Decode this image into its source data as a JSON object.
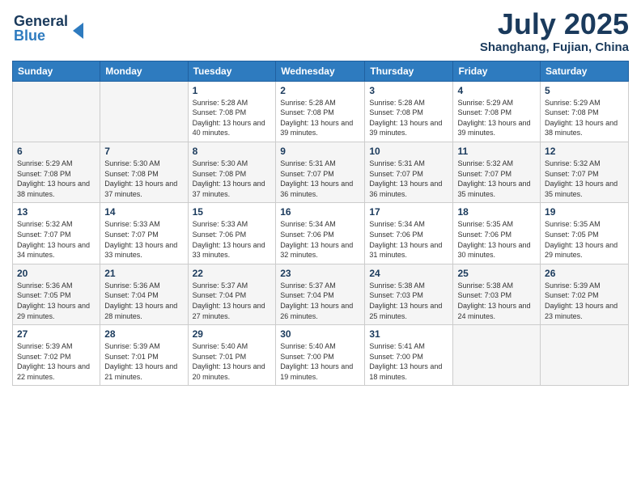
{
  "logo": {
    "line1": "General",
    "line2": "Blue"
  },
  "title": "July 2025",
  "location": "Shanghang, Fujian, China",
  "days_of_week": [
    "Sunday",
    "Monday",
    "Tuesday",
    "Wednesday",
    "Thursday",
    "Friday",
    "Saturday"
  ],
  "weeks": [
    [
      {
        "day": "",
        "info": ""
      },
      {
        "day": "",
        "info": ""
      },
      {
        "day": "1",
        "info": "Sunrise: 5:28 AM\nSunset: 7:08 PM\nDaylight: 13 hours and 40 minutes."
      },
      {
        "day": "2",
        "info": "Sunrise: 5:28 AM\nSunset: 7:08 PM\nDaylight: 13 hours and 39 minutes."
      },
      {
        "day": "3",
        "info": "Sunrise: 5:28 AM\nSunset: 7:08 PM\nDaylight: 13 hours and 39 minutes."
      },
      {
        "day": "4",
        "info": "Sunrise: 5:29 AM\nSunset: 7:08 PM\nDaylight: 13 hours and 39 minutes."
      },
      {
        "day": "5",
        "info": "Sunrise: 5:29 AM\nSunset: 7:08 PM\nDaylight: 13 hours and 38 minutes."
      }
    ],
    [
      {
        "day": "6",
        "info": "Sunrise: 5:29 AM\nSunset: 7:08 PM\nDaylight: 13 hours and 38 minutes."
      },
      {
        "day": "7",
        "info": "Sunrise: 5:30 AM\nSunset: 7:08 PM\nDaylight: 13 hours and 37 minutes."
      },
      {
        "day": "8",
        "info": "Sunrise: 5:30 AM\nSunset: 7:08 PM\nDaylight: 13 hours and 37 minutes."
      },
      {
        "day": "9",
        "info": "Sunrise: 5:31 AM\nSunset: 7:07 PM\nDaylight: 13 hours and 36 minutes."
      },
      {
        "day": "10",
        "info": "Sunrise: 5:31 AM\nSunset: 7:07 PM\nDaylight: 13 hours and 36 minutes."
      },
      {
        "day": "11",
        "info": "Sunrise: 5:32 AM\nSunset: 7:07 PM\nDaylight: 13 hours and 35 minutes."
      },
      {
        "day": "12",
        "info": "Sunrise: 5:32 AM\nSunset: 7:07 PM\nDaylight: 13 hours and 35 minutes."
      }
    ],
    [
      {
        "day": "13",
        "info": "Sunrise: 5:32 AM\nSunset: 7:07 PM\nDaylight: 13 hours and 34 minutes."
      },
      {
        "day": "14",
        "info": "Sunrise: 5:33 AM\nSunset: 7:07 PM\nDaylight: 13 hours and 33 minutes."
      },
      {
        "day": "15",
        "info": "Sunrise: 5:33 AM\nSunset: 7:06 PM\nDaylight: 13 hours and 33 minutes."
      },
      {
        "day": "16",
        "info": "Sunrise: 5:34 AM\nSunset: 7:06 PM\nDaylight: 13 hours and 32 minutes."
      },
      {
        "day": "17",
        "info": "Sunrise: 5:34 AM\nSunset: 7:06 PM\nDaylight: 13 hours and 31 minutes."
      },
      {
        "day": "18",
        "info": "Sunrise: 5:35 AM\nSunset: 7:06 PM\nDaylight: 13 hours and 30 minutes."
      },
      {
        "day": "19",
        "info": "Sunrise: 5:35 AM\nSunset: 7:05 PM\nDaylight: 13 hours and 29 minutes."
      }
    ],
    [
      {
        "day": "20",
        "info": "Sunrise: 5:36 AM\nSunset: 7:05 PM\nDaylight: 13 hours and 29 minutes."
      },
      {
        "day": "21",
        "info": "Sunrise: 5:36 AM\nSunset: 7:04 PM\nDaylight: 13 hours and 28 minutes."
      },
      {
        "day": "22",
        "info": "Sunrise: 5:37 AM\nSunset: 7:04 PM\nDaylight: 13 hours and 27 minutes."
      },
      {
        "day": "23",
        "info": "Sunrise: 5:37 AM\nSunset: 7:04 PM\nDaylight: 13 hours and 26 minutes."
      },
      {
        "day": "24",
        "info": "Sunrise: 5:38 AM\nSunset: 7:03 PM\nDaylight: 13 hours and 25 minutes."
      },
      {
        "day": "25",
        "info": "Sunrise: 5:38 AM\nSunset: 7:03 PM\nDaylight: 13 hours and 24 minutes."
      },
      {
        "day": "26",
        "info": "Sunrise: 5:39 AM\nSunset: 7:02 PM\nDaylight: 13 hours and 23 minutes."
      }
    ],
    [
      {
        "day": "27",
        "info": "Sunrise: 5:39 AM\nSunset: 7:02 PM\nDaylight: 13 hours and 22 minutes."
      },
      {
        "day": "28",
        "info": "Sunrise: 5:39 AM\nSunset: 7:01 PM\nDaylight: 13 hours and 21 minutes."
      },
      {
        "day": "29",
        "info": "Sunrise: 5:40 AM\nSunset: 7:01 PM\nDaylight: 13 hours and 20 minutes."
      },
      {
        "day": "30",
        "info": "Sunrise: 5:40 AM\nSunset: 7:00 PM\nDaylight: 13 hours and 19 minutes."
      },
      {
        "day": "31",
        "info": "Sunrise: 5:41 AM\nSunset: 7:00 PM\nDaylight: 13 hours and 18 minutes."
      },
      {
        "day": "",
        "info": ""
      },
      {
        "day": "",
        "info": ""
      }
    ]
  ]
}
